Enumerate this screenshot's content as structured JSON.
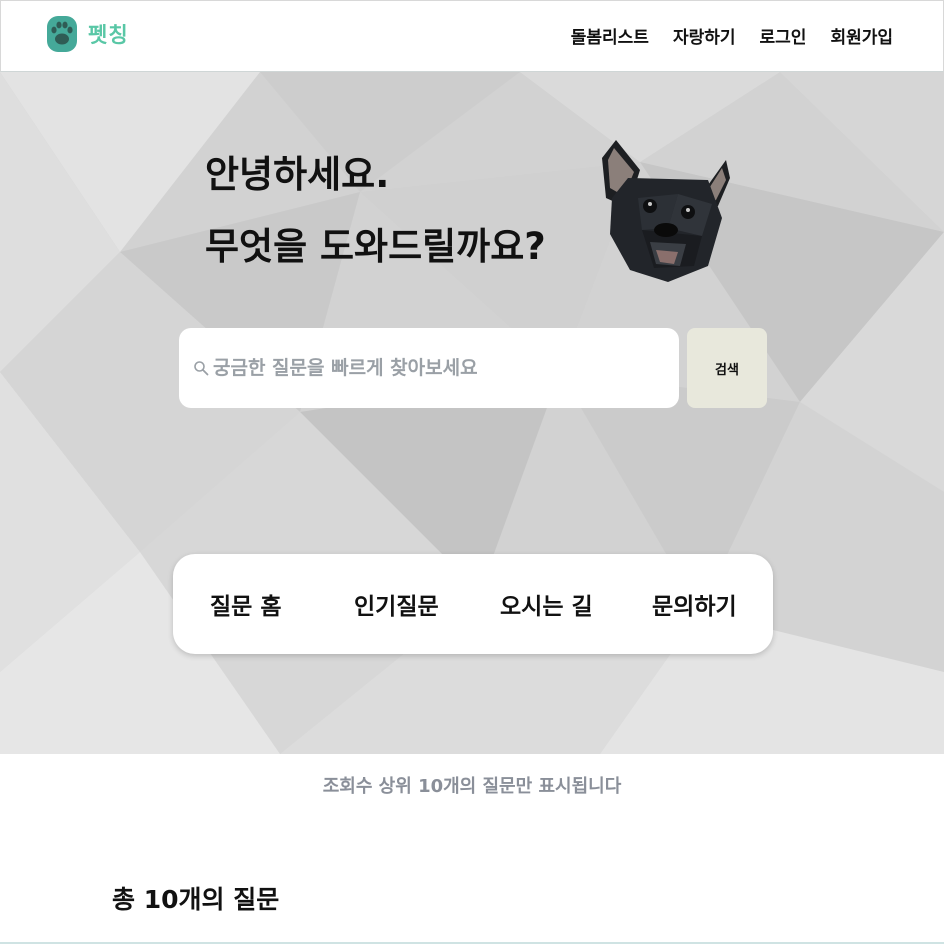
{
  "header": {
    "logo_text": "펫칭",
    "logo_icon": "paw-icon",
    "nav": [
      "돌봄리스트",
      "자랑하기",
      "로그인",
      "회원가입"
    ]
  },
  "hero": {
    "greeting_line1": "안녕하세요.",
    "greeting_line2": "무엇을 도와드릴까요?",
    "image": "french-bulldog-lowpoly"
  },
  "search": {
    "icon": "search-icon",
    "placeholder": "궁금한 질문을 빠르게 찾아보세요",
    "value": "",
    "button_label": "검색"
  },
  "menu": {
    "items": [
      "질문 홈",
      "인기질문",
      "오시는 길",
      "문의하기"
    ]
  },
  "notice": "조회수 상위 10개의 질문만 표시됩니다",
  "total_label": "총 10개의 질문",
  "colors": {
    "brand": "#59c7a6",
    "logo_icon": "#45a999",
    "hero_bg": "#d2d2d2",
    "search_button": "#e8e8dc",
    "notice_text": "#8a8f99"
  }
}
